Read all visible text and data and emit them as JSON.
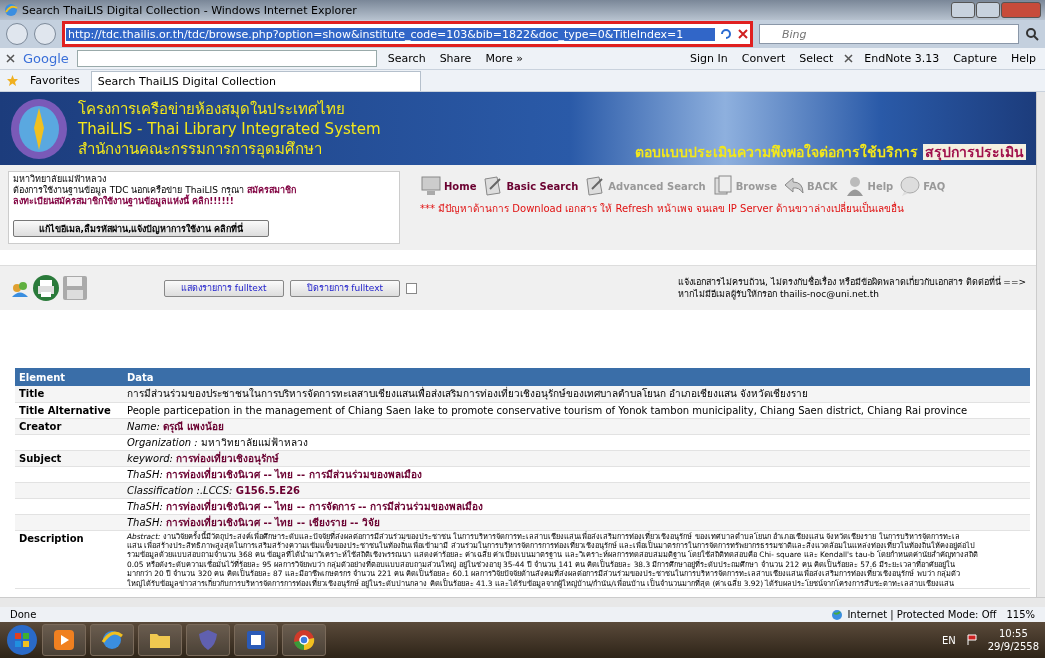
{
  "window": {
    "title": "Search ThaiLIS Digital Collection - Windows Internet Explorer"
  },
  "address_bar": {
    "url": "http://tdc.thailis.or.th/tdc/browse.php?option=show&institute_code=103&bib=1822&doc_type=0&TitleIndex=1",
    "highlighted": true
  },
  "search_box": {
    "placeholder": "Bing"
  },
  "google_toolbar": {
    "logo": "Google",
    "buttons": [
      "Search",
      "Share",
      "More »"
    ],
    "right_buttons": [
      "Sign In",
      "Convert",
      "Select"
    ],
    "addins": [
      "EndNote 3.13",
      "Capture",
      "Help"
    ]
  },
  "favorites_bar": {
    "label": "Favorites",
    "tabs": [
      {
        "title": "Search ThaiLIS Digital Collection",
        "selected": true
      }
    ]
  },
  "banner": {
    "lines": [
      "โครงการเครือข่ายห้องสมุดในประเทศไทย",
      "ThaiLIS - Thai Library Integrated System",
      "สำนักงานคณะกรรมการการอุดมศึกษา"
    ],
    "survey_link": "ตอบแบบประเมินความพึงพอใจต่อการใช้บริการ",
    "summary_link": "สรุปการประเมิน"
  },
  "member_box": {
    "university": "มหาวิทยาลัยแม่ฟ้าหลวง",
    "notice": "ต้องการใช้งานฐานข้อมูล TDC นอกเครือข่าย ThaiLIS กรุณา",
    "signup_link": "สมัครสมาชิก",
    "register_link": "ลงทะเบียนสมัครสมาชิกใช้งานฐานข้อมูลแห่งนี้ คลิก!!!!!!",
    "help_button": "แก้ไขอีเมล,ลืมรหัสผ่าน,แจ้งปัญหาการใช้งาน คลิกที่นี่"
  },
  "nav": [
    {
      "label": "Home",
      "disabled": false
    },
    {
      "label": "Basic Search",
      "disabled": false
    },
    {
      "label": "Advanced Search",
      "disabled": true
    },
    {
      "label": "Browse",
      "disabled": true
    },
    {
      "label": "BACK",
      "disabled": true
    },
    {
      "label": "Help",
      "disabled": true
    },
    {
      "label": "FAQ",
      "disabled": true
    }
  ],
  "warning": "*** มีปัญหาด้านการ Download เอกสาร ให้ Refresh หน้าเพจ จนเลข IP Server ด้านขวาล่างเปลี่ยนเป็นเลขอื่น",
  "fulltext_bar": {
    "show_button": "แสดงรายการ fulltext",
    "hide_button": "ปิดรายการ fulltext",
    "checked": false,
    "report_lines": [
      "แจ้งเอกสารไม่ครบถ้วน, ไม่ตรงกับชื่อเรื่อง หรือมีข้อผิดพลาดเกี่ยวกับเอกสาร ติดต่อที่นี่ ==>",
      "หากไม่มีอีเมลผู้รับให้กรอก thailis-noc@uni.net.th"
    ]
  },
  "table": {
    "columns": [
      "Element",
      "Data"
    ],
    "rows": [
      {
        "element": "Title",
        "kind": "text",
        "value": "การมีส่วนร่วมของประชาชนในการบริหารจัดการทะเลสาบเชียงแสนเพื่อส่งเสริมการท่องเที่ยวเชิงอนุรักษ์ของเทศบาลตำบลโยนก อำเภอเชียงแสน จังหวัดเชียงราย"
      },
      {
        "element": "Title Alternative",
        "kind": "text",
        "value": "People particepation in the management of Chiang Saen lake to promote conservative tourism of Yonok tambon municipality, Chiang Saen district, Chiang Rai province"
      },
      {
        "element": "Creator",
        "kind": "field",
        "label": "Name:",
        "value": "ดรุณี แพงน้อย",
        "emphasis": true
      },
      {
        "kind": "field",
        "label": "Organization :",
        "value": "มหาวิทยาลัยแม่ฟ้าหลวง",
        "emphasis": false
      },
      {
        "element": "Subject",
        "kind": "field",
        "label": "keyword:",
        "value": "การท่องเที่ยวเชิงอนุรักษ์",
        "emphasis": true
      },
      {
        "kind": "field",
        "label": "ThaSH:",
        "value": "การท่องเที่ยวเชิงนิเวศ -- ไทย -- การมีส่วนร่วมของพลเมือง",
        "emphasis": true
      },
      {
        "kind": "field",
        "label": "Classification :.LCCS:",
        "value": "G156.5.E26",
        "emphasis": true
      },
      {
        "kind": "field",
        "label": "ThaSH:",
        "value": "การท่องเที่ยวเชิงนิเวศ -- ไทย -- การจัดการ -- การมีส่วนร่วมของพลเมือง",
        "emphasis": true
      },
      {
        "kind": "field",
        "label": "ThaSH:",
        "value": "การท่องเที่ยวเชิงนิเวศ -- ไทย -- เชียงราย -- วิจัย",
        "emphasis": true
      },
      {
        "element": "Description",
        "kind": "paragraph",
        "label": "Abstract:",
        "lines": [
          "งานวิจัยครั้งนี้มีวัตถุประสงค์เพื่อศึกษาระดับและปัจจัยที่ส่งผลต่อการมีส่วนร่วมของประชาชน ในการบริหารจัดการทะเลสาบเชียงแสนเพื่อส่งเสริมการท่องเที่ยวเชิงอนุรักษ์ ของเทศบาลตำบลโยนก อำเภอเชียงแสน จังหวัดเชียงราย ในการบริหารจัดการทะเล",
          "แสน เพื่อสร้างประสิทธิภาพสูงสุดในการเสริมสร้างความเข้มแข็งของประชาชนในท้องถิ่นเพื่อเข้ามามี ส่วนร่วมในการบริหารจัดการการท่องเที่ยวเชิงอนุรักษ์ และเพื่อเป็นมาตรการในการจัดการทรัพยากรธรรมชาติและสิ่งแวดล้อมในแหล่งท่องเที่ยวในท้องถิ่นให้คงอยู่ต่อไป",
          "รวมข้อมูลด้วยแบบสอบถามจำนวน 368 คน ข้อมูลที่ได้นำมาวิเคราะห์ใช้สถิติเชิงพรรณนา แสดงค่าร้อยละ ค่าเฉลี่ย ค่าเบี่ยงเบนมาตรฐาน และวิเคราะห์ผลการทดสอบสมมติฐาน โดยใช้สถิติทดสอบคือ Chi- square และ Kendall's tau-b โดยกำหนดค่านัยสำคัญทางสถิติ",
          "0.05 หรือดังระดับความเชื่อมั่นไว้ที่ร้อยละ 95 ผลการวิจัยพบว่า กลุ่มตัวอย่างที่ตอบแบบสอบถามส่วนใหญ่ อยู่ในช่วงอายุ 35-44 ปี จำนวน 141 คน คิดเป็นร้อยละ 38.3 มีการศึกษาอยู่ที่ระดับประถมศึกษา จำนวน 212 คน คิดเป็นร้อยละ 57.6 มีระยะเวลาที่อาศัยอยู่ใน",
          "มากกว่า 20 ปี จำนวน 320 คน คิดเป็นร้อยละ 87 และมีอาชีพเกษตรกร จำนวน 221 คน คิดเป็นร้อยละ 60.1 ผลการวิจัยปัจจัยด้านสังคมที่ส่งผลต่อการมีส่วนร่วมของประชาชนในการบริหารจัดการทะเลสาบเชียงแสนเพื่อส่งเสริมการท่องเที่ยวเชิงอนุรักษ์ พบว่า กลุ่มตัว",
          "ใหญ่ได้รับข้อมูลข่าวสารเกี่ยวกับการบริหารจัดการการท่องเที่ยวเชิงอนุรักษ์ อยู่ในระดับปานกลาง คิดเป็นร้อยละ 41.3 และได้รับข้อมูลจากผู้ใหญ่บ้าน/กำนัน/เพื่อนบ้าน เป็นจำนวนมากที่สุด (ค่าเฉลี่ย 3.92) ได้รับผลประโยชน์จากโครงการสืบชะตาทะเลสาบเชียงแสน"
        ]
      }
    ]
  },
  "status_bar": {
    "status": "Done",
    "zone": "Internet | Protected Mode: Off",
    "zoom": "115%"
  },
  "taskbar": {
    "language": "EN",
    "time": "10:55",
    "date": "29/9/2558"
  }
}
